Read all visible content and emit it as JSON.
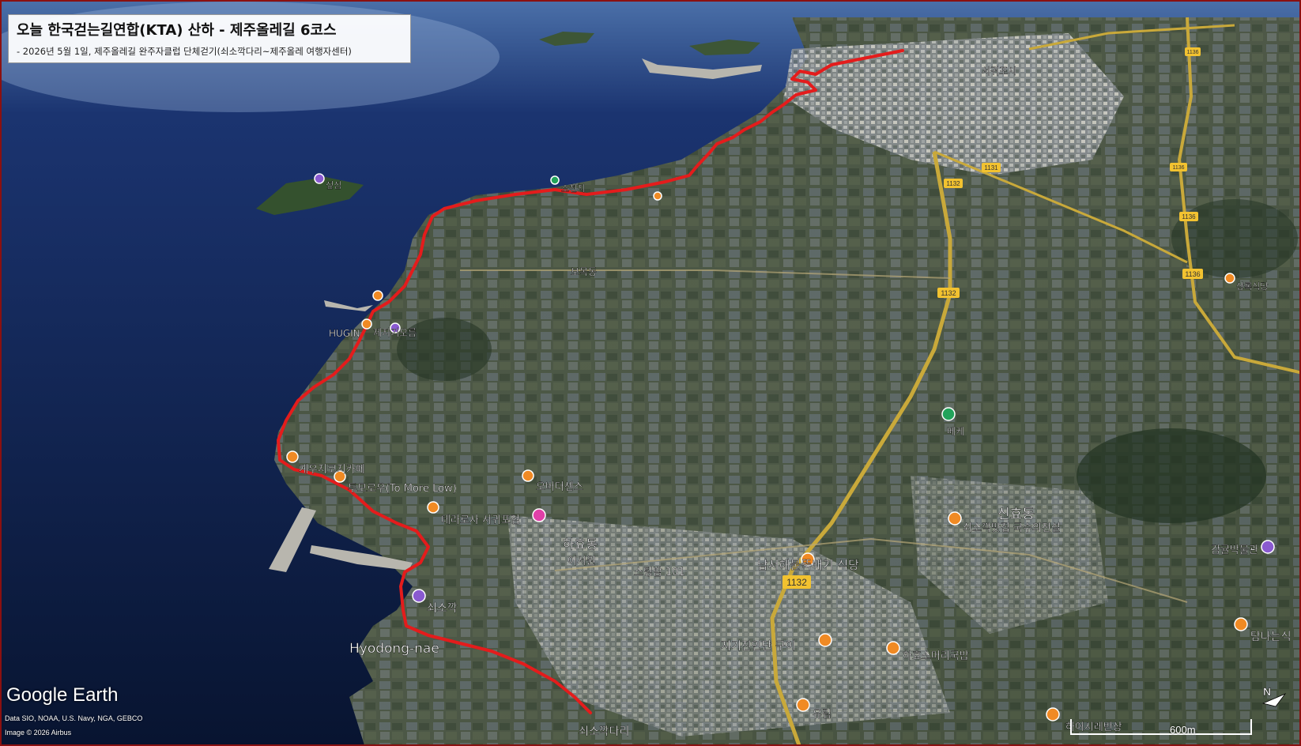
{
  "title": {
    "main": "오늘 한국걷는길연합(KTA) 산하 - 제주올레길 6코스",
    "subtitle": "- 2026년 5월 1일, 제주올레길 완주자클럽 단체걷기(쇠소깍다리~제주올레 여행자센터)"
  },
  "branding": {
    "logo": "Google Earth",
    "data_credit": "Data SIO, NOAA, U.S. Navy, NGA, GEBCO",
    "image_credit": "Image © 2026 Airbus"
  },
  "scale_bar": {
    "label": "600m"
  },
  "compass": {
    "label": "N",
    "icon": "north-arrow-icon"
  },
  "route": {
    "color": "#e41c1c",
    "name": "제주올레길 6코스"
  },
  "colors": {
    "sea": "#0b1a3e",
    "land": "#3d4a3a",
    "road_major": "#c9a93a",
    "route": "#e41c1c",
    "poi_orange": "#f08a24",
    "poi_purple": "#8a5ad0",
    "poi_green": "#22a35a",
    "poi_pink": "#e040a8",
    "highway_badge": "#f2c230"
  },
  "places": [
    {
      "label": "섶섬",
      "icon": "purple-pin-icon"
    },
    {
      "label": "소천지",
      "icon": "green-pin-icon"
    },
    {
      "label": "보목동",
      "icon": "none"
    },
    {
      "label": "HUGIN",
      "icon": "orange-pin-icon"
    },
    {
      "label": "제지기오름",
      "icon": "purple-pin-icon"
    },
    {
      "label": "게우지코지카페",
      "icon": "orange-pin-icon"
    },
    {
      "label": "투모로우(To More Low)",
      "icon": "orange-pin-icon"
    },
    {
      "label": "오버더센스",
      "icon": "orange-pin-icon"
    },
    {
      "label": "테라로사 서귀포점",
      "icon": "orange-pin-icon"
    },
    {
      "label": "하효동",
      "icon": "none"
    },
    {
      "label": "이서원",
      "icon": "none"
    },
    {
      "label": "쇠소깍",
      "icon": "purple-pin-icon"
    },
    {
      "label": "Hyodong-nae",
      "icon": "none"
    },
    {
      "label": "쇠소깍다리",
      "icon": "none"
    },
    {
      "label": "스팅밤 101",
      "icon": "none"
    },
    {
      "label": "남서해물뚝배기 식당",
      "icon": "orange-pin-icon"
    },
    {
      "label": "지기진인단 구이",
      "icon": "orange-pin-icon"
    },
    {
      "label": "하효소머리국밥",
      "icon": "orange-pin-icon"
    },
    {
      "label": "유림",
      "icon": "orange-pin-icon"
    },
    {
      "label": "신효동",
      "icon": "none"
    },
    {
      "label": "쇠소깍맛집 국수의전설",
      "icon": "orange-pin-icon"
    },
    {
      "label": "감귤박물관",
      "icon": "purple-pin-icon"
    },
    {
      "label": "탐나는식",
      "icon": "orange-pin-icon"
    },
    {
      "label": "하어시레반상",
      "icon": "orange-pin-icon"
    },
    {
      "label": "서귀포시",
      "icon": "none"
    },
    {
      "label": "상록식당",
      "icon": "orange-pin-icon"
    },
    {
      "label": "베케",
      "icon": "green-pin-icon"
    }
  ],
  "road_badges": [
    "1132",
    "1132",
    "1132",
    "1131",
    "1136",
    "1136",
    "1136",
    "1136"
  ]
}
